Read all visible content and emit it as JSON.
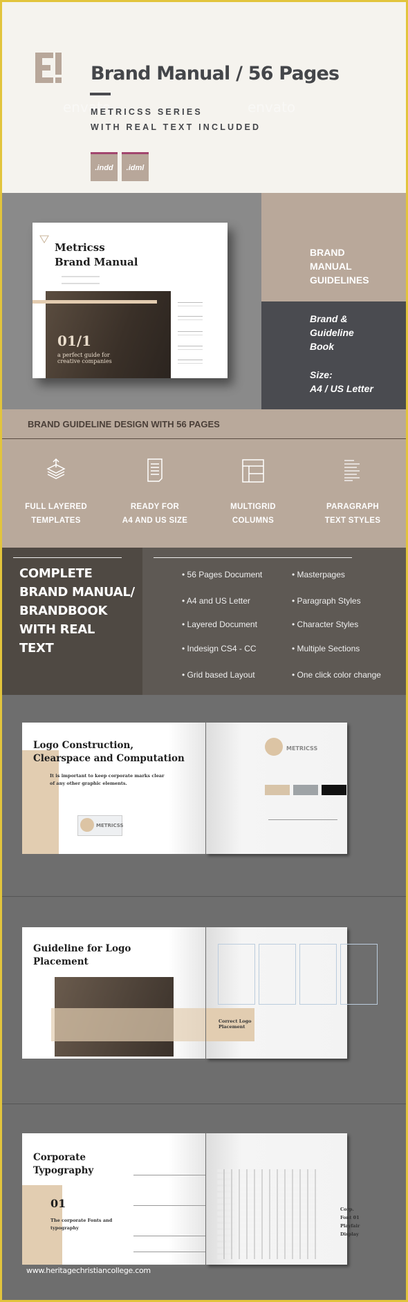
{
  "hero": {
    "title": "Brand Manual / 56 Pages",
    "subtitle_1": "METRICSS SERIES",
    "subtitle_2": "WITH REAL TEXT INCLUDED",
    "badges": [
      ".indd",
      ".idml"
    ],
    "watermark": "envato"
  },
  "cover": {
    "book_title_1": "Metricss",
    "book_title_2": "Brand Manual",
    "number": "01/1",
    "tagline_1": "a perfect guide for",
    "tagline_2": "creative companies"
  },
  "side": {
    "heading": [
      "BRAND",
      "MANUAL",
      "GUIDELINES"
    ],
    "italic": [
      "Brand &",
      "Guideline",
      "Book"
    ],
    "size_label": "Size:",
    "size_value": "A4 / US Letter"
  },
  "band": {
    "title": "BRAND GUIDELINE DESIGN WITH 56 PAGES",
    "features": [
      {
        "icon": "layers-icon",
        "line1": "FULL LAYERED",
        "line2": "TEMPLATES"
      },
      {
        "icon": "document-icon",
        "line1": "READY FOR",
        "line2": "A4 AND US SIZE"
      },
      {
        "icon": "grid-layout-icon",
        "line1": "MULTIGRID",
        "line2": "COLUMNS"
      },
      {
        "icon": "paragraph-icon",
        "line1": "PARAGRAPH",
        "line2": "TEXT STYLES"
      }
    ]
  },
  "complete": {
    "headline": [
      "COMPLETE",
      "BRAND MANUAL/",
      "BRANDBOOK",
      "WITH REAL",
      "TEXT"
    ],
    "bullets_left": [
      "• 56 Pages Document",
      "• A4 and US Letter",
      "• Layered Document",
      "• Indesign CS4 - CC",
      "• Grid based Layout"
    ],
    "bullets_right": [
      "• Masterpages",
      "• Paragraph Styles",
      "• Character Styles",
      "• Multiple Sections",
      "• One click color change"
    ]
  },
  "spread1": {
    "title_1": "Logo Construction,",
    "title_2": "Clearspace and Computation",
    "lead_1": "It is important to keep corporate marks clear",
    "lead_2": "of any other graphic elements.",
    "logo_word": "METRICSS"
  },
  "spread2": {
    "title_1": "Guideline for Logo",
    "title_2": "Placement",
    "caption_1": "Correct Logo",
    "caption_2": "Placement"
  },
  "spread3": {
    "title_1": "Corporate",
    "title_2": "Typography",
    "number": "01",
    "sub_1": "The corporate Fonts and",
    "sub_2": "typography",
    "font_1": "Corp. Font 01",
    "font_2": "Playfair Display"
  },
  "footer": {
    "url": "www.heritagechristiancollege.com"
  },
  "colors": {
    "tan": "#b9a89a",
    "dark": "#4a4b50",
    "gray": "#8a8a8a",
    "badge_accent": "#a2466e",
    "border": "#e2c43c"
  }
}
